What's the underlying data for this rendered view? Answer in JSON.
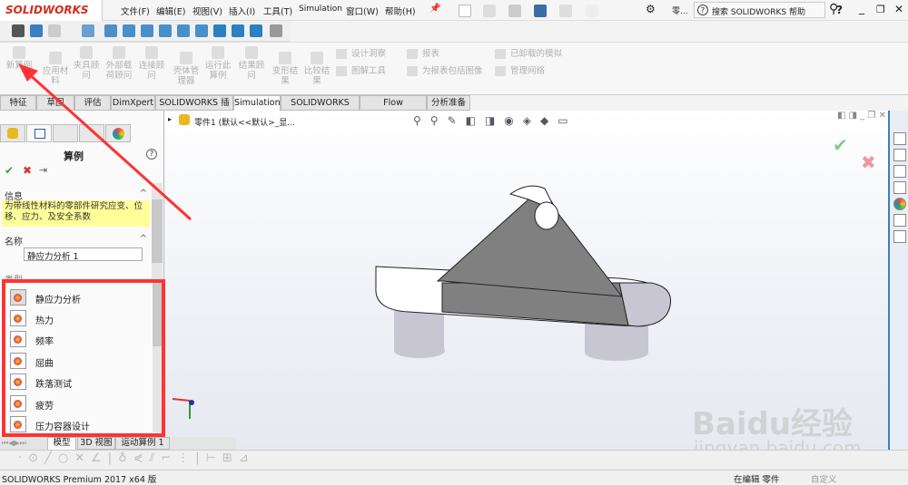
{
  "app": {
    "logo": "SOLIDWORKS",
    "version_status": "SOLIDWORKS Premium 2017 x64 版"
  },
  "menu": [
    "文件(F)",
    "编辑(E)",
    "视图(V)",
    "插入(I)",
    "工具(T)",
    "Simulation",
    "窗口(W)",
    "帮助(H)"
  ],
  "quick": {
    "doc_name": "零...",
    "search_placeholder": "搜索 SOLIDWORKS 帮助",
    "help": "?"
  },
  "ribbon": {
    "big": [
      "新算例",
      "应用材料",
      "夹具顾问",
      "外部载荷顾问",
      "连接顾问",
      "壳体管理器",
      "运行此算例",
      "结果顾问",
      "变形结果",
      "比较结果"
    ],
    "small": [
      "设计洞察",
      "图解工具",
      "报表",
      "为报表包括图像",
      "已卸载的模拟",
      "管理网络"
    ]
  },
  "tabs": [
    "特征",
    "草图",
    "评估",
    "DimXpert",
    "SOLIDWORKS 插件",
    "Simulation",
    "SOLIDWORKS MBD",
    "Flow Simulation",
    "分析准备"
  ],
  "panel": {
    "title": "算例",
    "info_header": "信息",
    "info_text": "为带线性材料的零部件研究应变、位移、应力、及安全系数",
    "name_header": "名称",
    "name_value": "静应力分析 1",
    "type_header": "类型",
    "types": [
      "静应力分析",
      "热力",
      "频率",
      "屈曲",
      "跌落测试",
      "疲劳",
      "压力容器设计"
    ]
  },
  "tree": {
    "root": "零件1  (默认<<默认>_显..."
  },
  "bottom_tabs": [
    "模型",
    "3D 视图",
    "运动算例 1"
  ],
  "status": {
    "editing": "在编辑 零件",
    "custom": "自定义"
  },
  "watermark": {
    "brand": "Baidu经验",
    "url": "jingyan.baidu.com"
  },
  "colors": {
    "highlight": "#ff3333",
    "info_bg": "#ffff99"
  }
}
